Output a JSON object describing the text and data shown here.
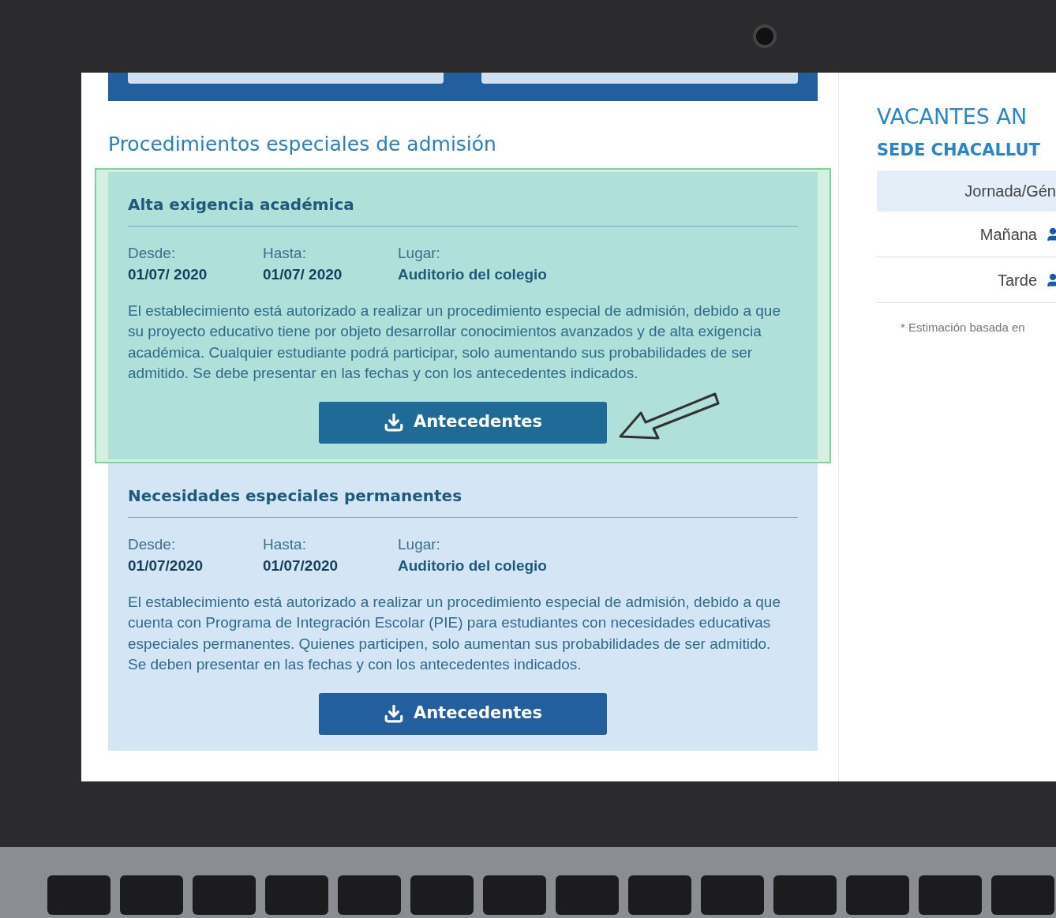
{
  "section_title": "Procedimientos especiales de admisión",
  "procedures": [
    {
      "title": "Alta exigencia académica",
      "highlighted": true,
      "from_label": "Desde:",
      "from": "01/07/ 2020",
      "to_label": "Hasta:",
      "to": "01/07/ 2020",
      "place_label": "Lugar:",
      "place": "Auditorio del colegio",
      "description": "El establecimiento está autorizado a realizar un procedimiento especial de admisión, debido a que su proyecto educativo tiene por objeto desarrollar conocimientos avanzados y de alta exigencia académica. Cualquier estudiante podrá participar, solo aumentando sus probabilidades de ser admitido. Se debe presentar en las fechas y con los antecedentes indicados.",
      "button": "Antecedentes"
    },
    {
      "title": "Necesidades especiales permanentes",
      "highlighted": false,
      "from_label": "Desde:",
      "from": "01/07/2020",
      "to_label": "Hasta:",
      "to": "01/07/2020",
      "place_label": "Lugar:",
      "place": "Auditorio del colegio",
      "description": "El establecimiento está autorizado a realizar un procedimiento especial de admisión, debido a que cuenta con Programa de Integración Escolar (PIE) para estudiantes con necesidades educativas especiales permanentes. Quienes participen, solo aumentan sus probabilidades de ser admitido. Se deben presentar en las fechas y con los antecedentes indicados.",
      "button": "Antecedentes"
    }
  ],
  "sidebar": {
    "title": "VACANTES AN",
    "subtitle": "SEDE CHACALLUT",
    "table_header": "Jornada/Gén",
    "rows": [
      {
        "label": "Mañana"
      },
      {
        "label": "Tarde"
      }
    ],
    "footnote": "* Estimación basada en"
  }
}
